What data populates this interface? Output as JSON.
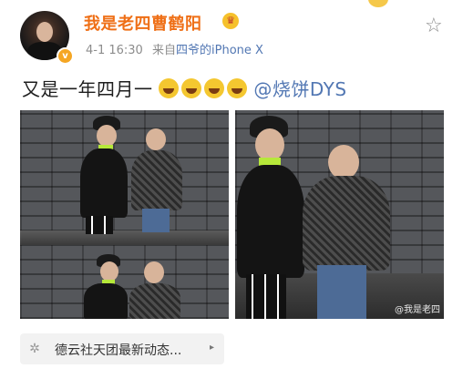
{
  "header": {
    "username": "我是老四曹鹤阳",
    "timestamp": "4-1 16:30",
    "source_prefix": "来自",
    "source_name": "四爷的iPhone X"
  },
  "post": {
    "text": "又是一年四月一",
    "emoji_count": 4,
    "mention": "@烧饼DYS"
  },
  "photos": {
    "watermark": "@我是老四"
  },
  "footer_card": {
    "text": "德云社天团最新动态...",
    "arrow": "▸"
  },
  "icons": {
    "star": "☆",
    "vip_badge": "v",
    "crown": "♛",
    "card_icon": "✲"
  },
  "colors": {
    "username": "#ef6f16",
    "link": "#5277b3",
    "meta": "#8c8c8c",
    "collar": "#b6e83a"
  }
}
